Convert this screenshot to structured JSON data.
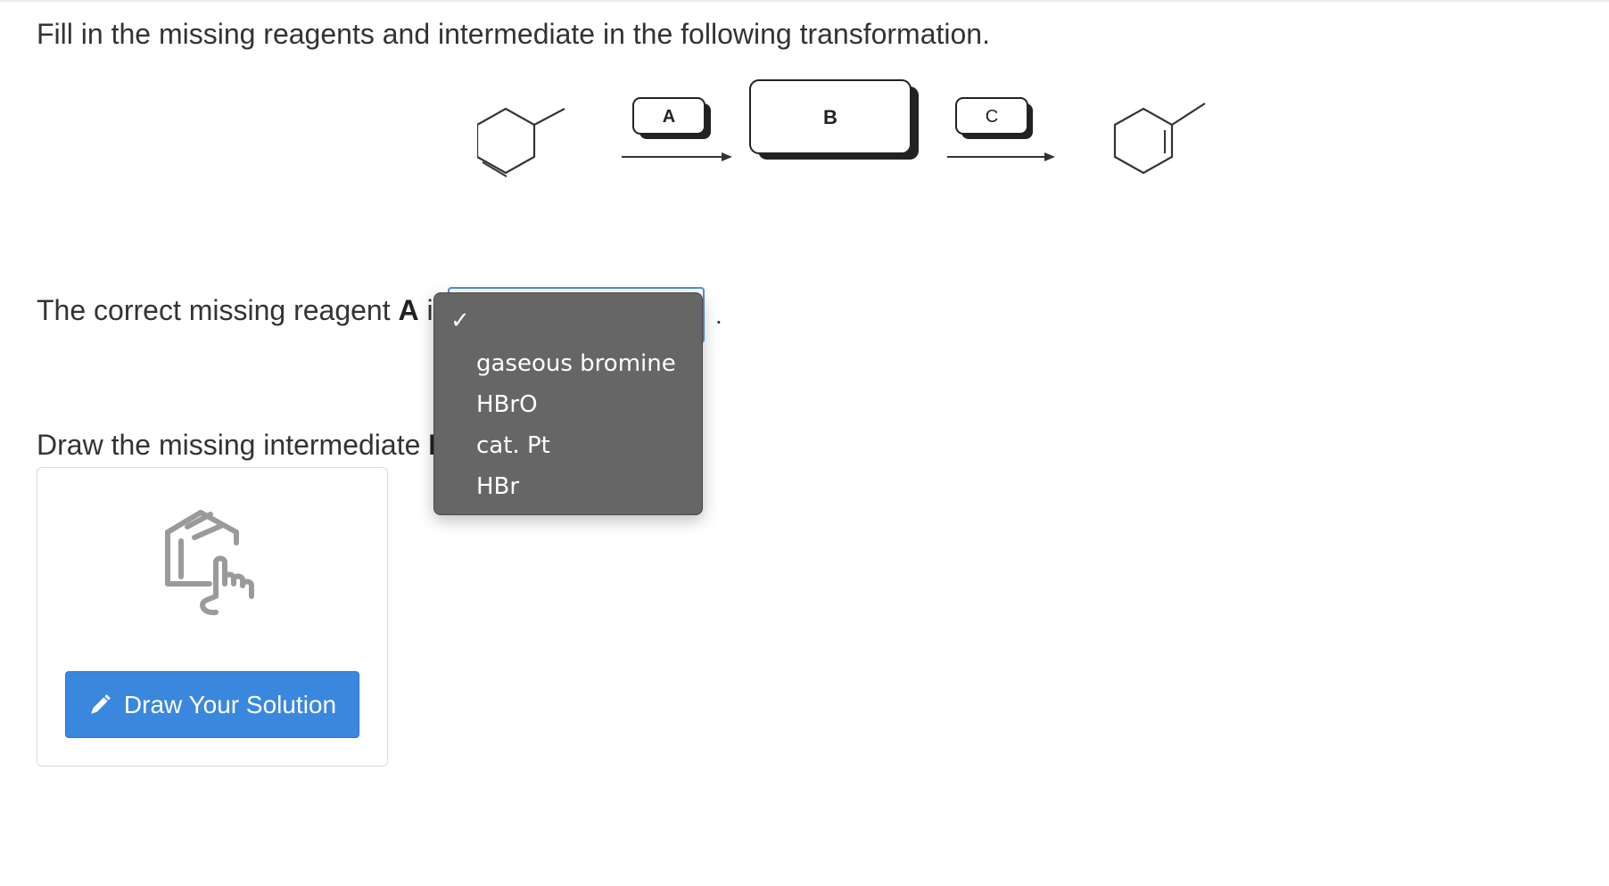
{
  "question": {
    "prompt": "Fill in the missing reagents and intermediate in the following transformation."
  },
  "scheme": {
    "label_a": "A",
    "label_b": "B",
    "label_c": "C"
  },
  "reagent_question": {
    "prefix": "The correct missing reagent ",
    "bold": "A",
    "suffix": " is",
    "trailing": "."
  },
  "dropdown": {
    "selected_mark": "✓",
    "options": [
      "gaseous bromine",
      "HBrO",
      "cat. Pt",
      "HBr"
    ]
  },
  "draw_question": {
    "prefix": "Draw the missing intermediate ",
    "bold": "B"
  },
  "draw_card": {
    "button_label": "Draw Your Solution",
    "icon": "molecule-hand-icon",
    "button_icon": "pencil-icon"
  },
  "colors": {
    "button": "#3a87de",
    "dropdown_bg": "#666666",
    "select_border": "#4f8fd8"
  }
}
